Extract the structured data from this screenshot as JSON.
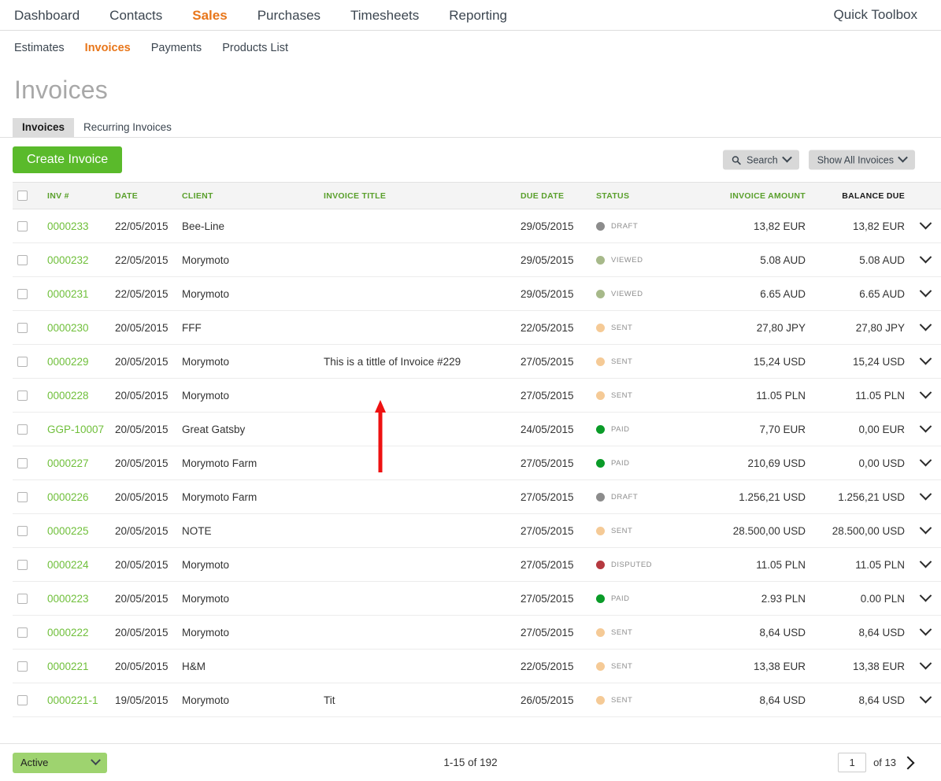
{
  "topnav": {
    "items": [
      {
        "label": "Dashboard",
        "active": false
      },
      {
        "label": "Contacts",
        "active": false
      },
      {
        "label": "Sales",
        "active": true
      },
      {
        "label": "Purchases",
        "active": false
      },
      {
        "label": "Timesheets",
        "active": false
      },
      {
        "label": "Reporting",
        "active": false
      }
    ],
    "quick_toolbox": "Quick Toolbox"
  },
  "subnav": {
    "items": [
      {
        "label": "Estimates",
        "active": false
      },
      {
        "label": "Invoices",
        "active": true
      },
      {
        "label": "Payments",
        "active": false
      },
      {
        "label": "Products List",
        "active": false
      }
    ]
  },
  "page": {
    "title": "Invoices"
  },
  "tabs": [
    {
      "label": "Invoices",
      "active": true
    },
    {
      "label": "Recurring Invoices",
      "active": false
    }
  ],
  "toolbar": {
    "create_label": "Create Invoice",
    "search_label": "Search",
    "filter_label": "Show All Invoices"
  },
  "table": {
    "columns": [
      {
        "key": "check",
        "label": ""
      },
      {
        "key": "inv",
        "label": "INV #"
      },
      {
        "key": "date",
        "label": "DATE"
      },
      {
        "key": "client",
        "label": "CLIENT"
      },
      {
        "key": "title",
        "label": "INVOICE TITLE"
      },
      {
        "key": "due",
        "label": "DUE DATE"
      },
      {
        "key": "status",
        "label": "STATUS"
      },
      {
        "key": "amount",
        "label": "INVOICE AMOUNT"
      },
      {
        "key": "balance",
        "label": "BALANCE DUE"
      },
      {
        "key": "expand",
        "label": ""
      }
    ],
    "status_colors": {
      "DRAFT": "#8c8c8c",
      "VIEWED": "#a7b98a",
      "SENT": "#f5ca96",
      "PAID": "#0a9b28",
      "DISPUTED": "#b5393f"
    },
    "rows": [
      {
        "inv": "0000233",
        "date": "22/05/2015",
        "client": "Bee-Line",
        "title": "",
        "due": "29/05/2015",
        "status": "DRAFT",
        "amount": "13,82 EUR",
        "balance": "13,82 EUR"
      },
      {
        "inv": "0000232",
        "date": "22/05/2015",
        "client": "Morymoto",
        "title": "",
        "due": "29/05/2015",
        "status": "VIEWED",
        "amount": "5.08 AUD",
        "balance": "5.08 AUD"
      },
      {
        "inv": "0000231",
        "date": "22/05/2015",
        "client": "Morymoto",
        "title": "",
        "due": "29/05/2015",
        "status": "VIEWED",
        "amount": "6.65 AUD",
        "balance": "6.65 AUD"
      },
      {
        "inv": "0000230",
        "date": "20/05/2015",
        "client": "FFF",
        "title": "",
        "due": "22/05/2015",
        "status": "SENT",
        "amount": "27,80 JPY",
        "balance": "27,80 JPY"
      },
      {
        "inv": "0000229",
        "date": "20/05/2015",
        "client": "Morymoto",
        "title": "This is a tittle of Invoice #229",
        "due": "27/05/2015",
        "status": "SENT",
        "amount": "15,24 USD",
        "balance": "15,24 USD"
      },
      {
        "inv": "0000228",
        "date": "20/05/2015",
        "client": "Morymoto",
        "title": "",
        "due": "27/05/2015",
        "status": "SENT",
        "amount": "11.05 PLN",
        "balance": "11.05 PLN"
      },
      {
        "inv": "GGP-10007",
        "date": "20/05/2015",
        "client": "Great Gatsby",
        "title": "",
        "due": "24/05/2015",
        "status": "PAID",
        "amount": "7,70 EUR",
        "balance": "0,00 EUR"
      },
      {
        "inv": "0000227",
        "date": "20/05/2015",
        "client": "Morymoto Farm",
        "title": "",
        "due": "27/05/2015",
        "status": "PAID",
        "amount": "210,69 USD",
        "balance": "0,00 USD"
      },
      {
        "inv": "0000226",
        "date": "20/05/2015",
        "client": "Morymoto Farm",
        "title": "",
        "due": "27/05/2015",
        "status": "DRAFT",
        "amount": "1.256,21 USD",
        "balance": "1.256,21 USD"
      },
      {
        "inv": "0000225",
        "date": "20/05/2015",
        "client": "NOTE",
        "title": "",
        "due": "27/05/2015",
        "status": "SENT",
        "amount": "28.500,00 USD",
        "balance": "28.500,00 USD"
      },
      {
        "inv": "0000224",
        "date": "20/05/2015",
        "client": "Morymoto",
        "title": "",
        "due": "27/05/2015",
        "status": "DISPUTED",
        "amount": "11.05 PLN",
        "balance": "11.05 PLN"
      },
      {
        "inv": "0000223",
        "date": "20/05/2015",
        "client": "Morymoto",
        "title": "",
        "due": "27/05/2015",
        "status": "PAID",
        "amount": "2.93 PLN",
        "balance": "0.00 PLN"
      },
      {
        "inv": "0000222",
        "date": "20/05/2015",
        "client": "Morymoto",
        "title": "",
        "due": "27/05/2015",
        "status": "SENT",
        "amount": "8,64 USD",
        "balance": "8,64 USD"
      },
      {
        "inv": "0000221",
        "date": "20/05/2015",
        "client": "H&M",
        "title": "",
        "due": "22/05/2015",
        "status": "SENT",
        "amount": "13,38 EUR",
        "balance": "13,38 EUR"
      },
      {
        "inv": "0000221-1",
        "date": "19/05/2015",
        "client": "Morymoto",
        "title": "Tit",
        "due": "26/05/2015",
        "status": "SENT",
        "amount": "8,64 USD",
        "balance": "8,64 USD"
      }
    ]
  },
  "footer": {
    "filter_label": "Active",
    "range": "1-15 of 192",
    "page_value": "1",
    "page_of": "of 13"
  },
  "annotation": {
    "arrow_color": "#ee1111"
  }
}
